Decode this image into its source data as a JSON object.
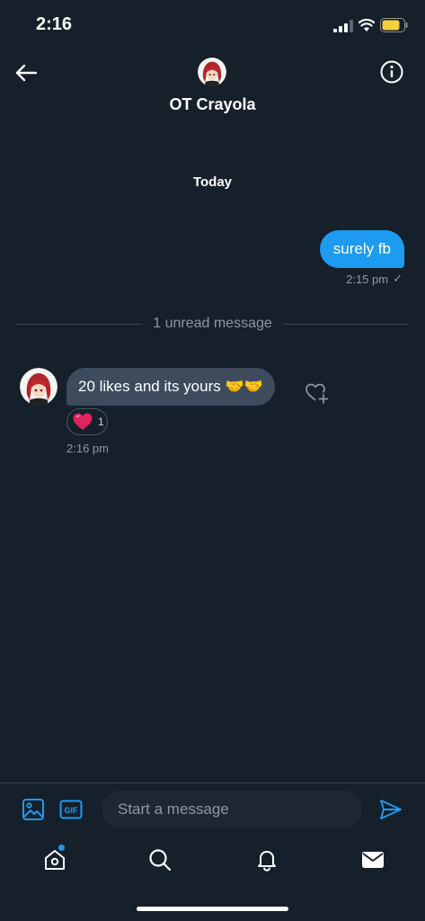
{
  "status_bar": {
    "time": "2:16"
  },
  "header": {
    "title": "OT Crayola"
  },
  "conversation": {
    "date_label": "Today",
    "sent_message": {
      "text": "surely fb",
      "time": "2:15 pm"
    },
    "unread_label": "1 unread message",
    "received_message": {
      "text": "20 likes and its yours 🤝🤝",
      "time": "2:16 pm",
      "reaction": {
        "icon": "heart-icon",
        "count": "1"
      }
    }
  },
  "composer": {
    "placeholder": "Start a message"
  },
  "tab_bar": {
    "items": [
      {
        "icon": "home-icon"
      },
      {
        "icon": "search-icon"
      },
      {
        "icon": "bell-icon"
      },
      {
        "icon": "mail-icon"
      }
    ]
  },
  "colors": {
    "background": "#15202b",
    "accent": "#1d9bf0",
    "received_bubble": "#3d4b5c"
  }
}
